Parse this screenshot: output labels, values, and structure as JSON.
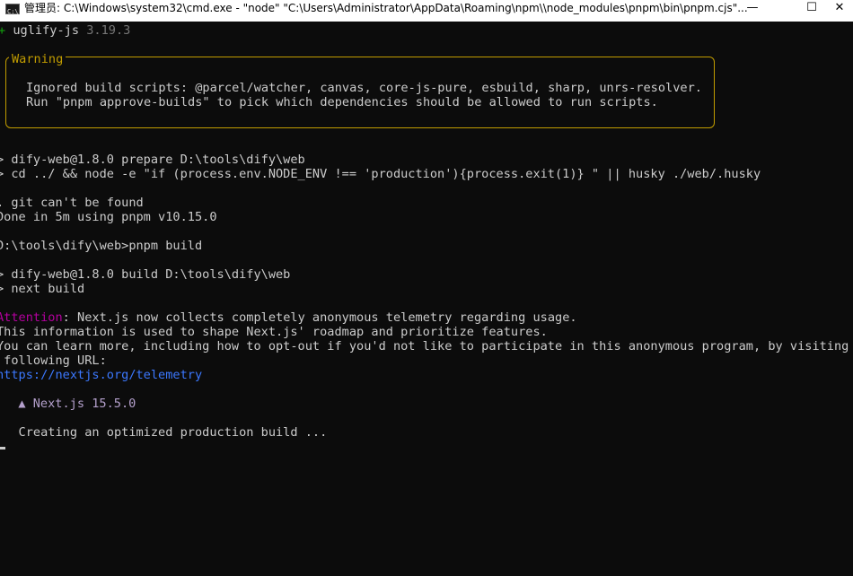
{
  "window": {
    "title": "管理员:  C:\\Windows\\system32\\cmd.exe  - \"node\"   \"C:\\Users\\Administrator\\AppData\\Roaming\\npm\\\\node_modules\\pnpm\\bin\\pnpm.cjs\"...",
    "icon_label": "C:\\",
    "minimize": "—",
    "maximize": "☐",
    "close": "✕"
  },
  "terminal": {
    "pkg_line": {
      "prefix": "+ ",
      "name": "uglify-js",
      "version": " 3.19.3"
    },
    "warning_box": {
      "title": "Warning",
      "line1": "Ignored build scripts: @parcel/watcher, canvas, core-js-pure, esbuild, sharp, unrs-resolver.",
      "line2": "Run \"pnpm approve-builds\" to pick which dependencies should be allowed to run scripts."
    },
    "prepare_1": "> dify-web@1.8.0 prepare D:\\tools\\dify\\web",
    "prepare_2": "> cd ../ && node -e \"if (process.env.NODE_ENV !== 'production'){process.exit(1)} \" || husky ./web/.husky",
    "git_msg": ". git can't be found",
    "done_msg": "Done in 5m using pnpm v10.15.0",
    "prompt_cmd": "D:\\tools\\dify\\web>pnpm build",
    "build_1": "> dify-web@1.8.0 build D:\\tools\\dify\\web",
    "build_2": "> next build",
    "attention_label": "Attention",
    "attention_rest": ": Next.js now collects completely anonymous telemetry regarding usage.",
    "info_1": "This information is used to shape Next.js' roadmap and prioritize features.",
    "info_2": "You can learn more, including how to opt-out if you'd not like to participate in this anonymous program, by visiting the",
    "info_3": " following URL:",
    "url": "https://nextjs.org/telemetry",
    "nextjs_banner": "  ▲ Next.js 15.5.0",
    "creating": "   Creating an optimized production build ..."
  },
  "colors": {
    "background": "#0c0c0c",
    "text": "#cccccc",
    "warning": "#c19c00",
    "attention": "#b4009e",
    "link": "#3b78ff"
  }
}
